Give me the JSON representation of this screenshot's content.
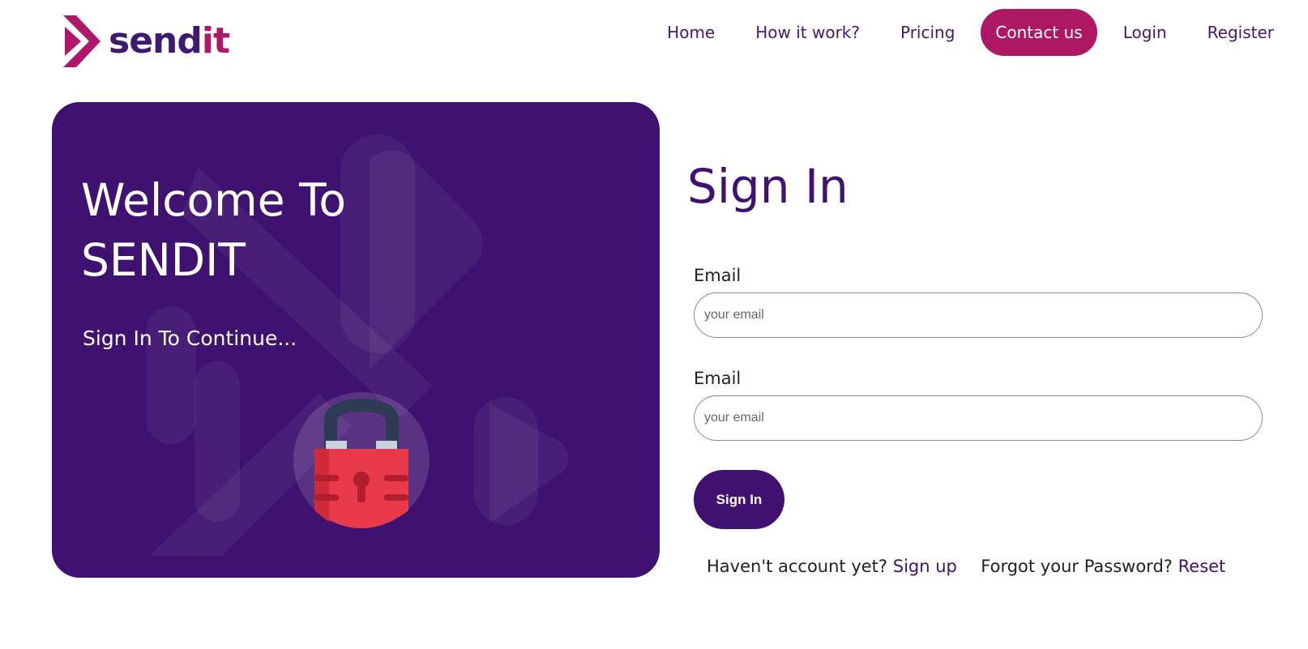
{
  "brand": {
    "name_part1": "send",
    "name_part2": "it",
    "colors": {
      "primary": "#3f1170",
      "accent": "#ad1763"
    }
  },
  "nav": {
    "items": [
      {
        "label": "Home",
        "active": false
      },
      {
        "label": "How it work?",
        "active": false
      },
      {
        "label": "Pricing",
        "active": false
      },
      {
        "label": "Contact us",
        "active": true
      },
      {
        "label": "Login",
        "active": false
      },
      {
        "label": "Register",
        "active": false
      }
    ]
  },
  "welcome": {
    "title_line1": "Welcome To",
    "title_line2": "SENDIT",
    "subtitle": "Sign In To Continue...",
    "illustration_icon": "padlock-icon"
  },
  "signin": {
    "title": "Sign In",
    "fields": [
      {
        "label": "Email",
        "placeholder": "your email",
        "value": ""
      },
      {
        "label": "Email",
        "placeholder": "your email",
        "value": ""
      }
    ],
    "button_label": "Sign In",
    "no_account_text": "Haven't account yet?",
    "signup_link": "Sign up",
    "forgot_text": "Forgot your Password?",
    "reset_link": "Reset"
  }
}
